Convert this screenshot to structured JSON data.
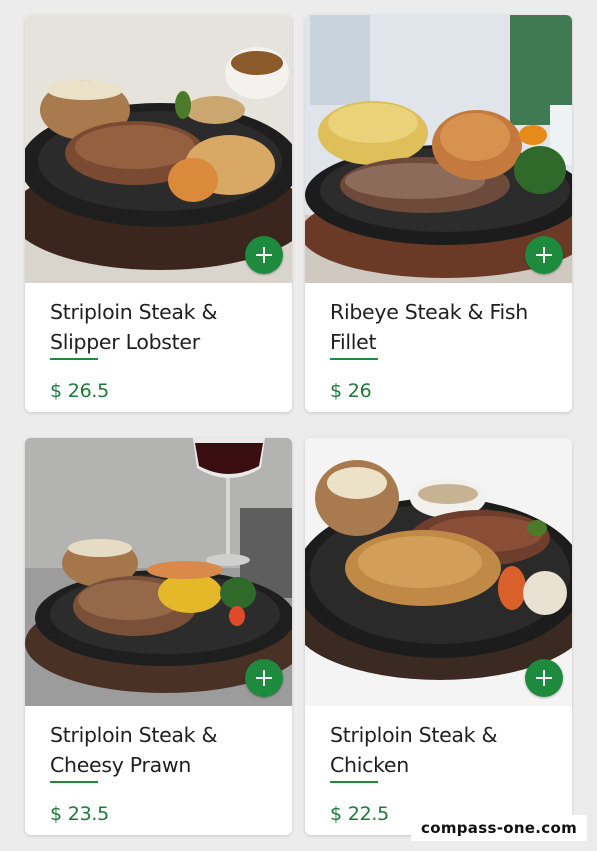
{
  "theme": {
    "accent": "#1d8a3e",
    "price_color": "#1d7a38"
  },
  "menu_items": [
    {
      "name_line1": "Striploin Steak &",
      "name_line2": "Slipper Lobster",
      "currency": "$",
      "price": "26.5",
      "add_icon": "plus-icon"
    },
    {
      "name_line1": "Ribeye Steak & Fish",
      "name_line2": "Fillet",
      "currency": "$",
      "price": "26",
      "add_icon": "plus-icon"
    },
    {
      "name_line1": "Striploin Steak &",
      "name_line2": "Cheesy Prawn",
      "currency": "$",
      "price": "23.5",
      "add_icon": "plus-icon"
    },
    {
      "name_line1": "Striploin Steak &",
      "name_line2": "Chicken",
      "currency": "$",
      "price": "22.5",
      "add_icon": "plus-icon"
    }
  ],
  "watermark": "compass-one.com"
}
